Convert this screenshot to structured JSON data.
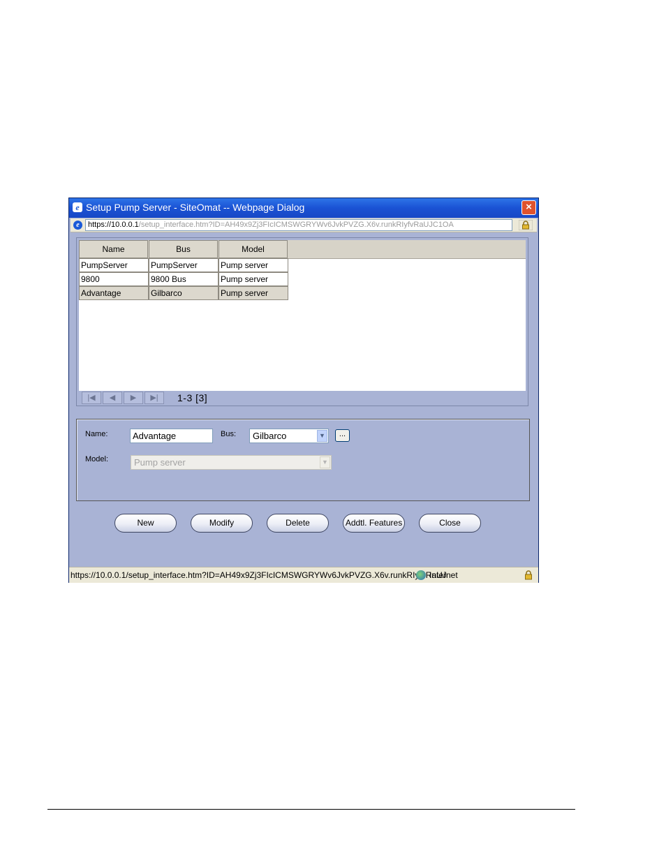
{
  "window": {
    "title": "Setup Pump Server - SiteOmat -- Webpage Dialog",
    "close_label": "×"
  },
  "address": {
    "scheme": "https://",
    "host": "10.0.0.1",
    "path": "/setup_interface.htm?ID=AH49x9Zj3FIcICMSWGRYWv6JvkPVZG.X6v.runkRIyfvRaUJC1OA"
  },
  "grid": {
    "columns": [
      "Name",
      "Bus",
      "Model"
    ],
    "rows": [
      {
        "name": "PumpServer",
        "bus": "PumpServer",
        "model": "Pump server"
      },
      {
        "name": "9800",
        "bus": "9800 Bus",
        "model": "Pump server"
      },
      {
        "name": "Advantage",
        "bus": "Gilbarco",
        "model": "Pump server"
      }
    ],
    "selected_row": 2,
    "pager": {
      "first": "|◀",
      "prev": "◀",
      "next": "▶",
      "last": "▶|",
      "info": "1-3 [3]"
    }
  },
  "form": {
    "name_label": "Name:",
    "name_value": "Advantage",
    "bus_label": "Bus:",
    "bus_value": "Gilbarco",
    "dots_label": "...",
    "model_label": "Model:",
    "model_value": "Pump server"
  },
  "buttons": {
    "new": "New",
    "modify": "Modify",
    "delete": "Delete",
    "features": "Addtl. Features",
    "close": "Close"
  },
  "status": {
    "url": "https://10.0.0.1/setup_interface.htm?ID=AH49x9Zj3FIcICMSWGRYWv6JvkPVZG.X6v.runkRIyfvRaUJ",
    "zone": "Internet"
  },
  "icons": {
    "title": "ie-icon",
    "address": "ie-page-icon",
    "lock": "lock-icon",
    "zone": "globe-icon"
  },
  "colors": {
    "dialog_bg": "#a9b3d5",
    "titlebar": "#1a52d4",
    "close": "#e0532e"
  }
}
